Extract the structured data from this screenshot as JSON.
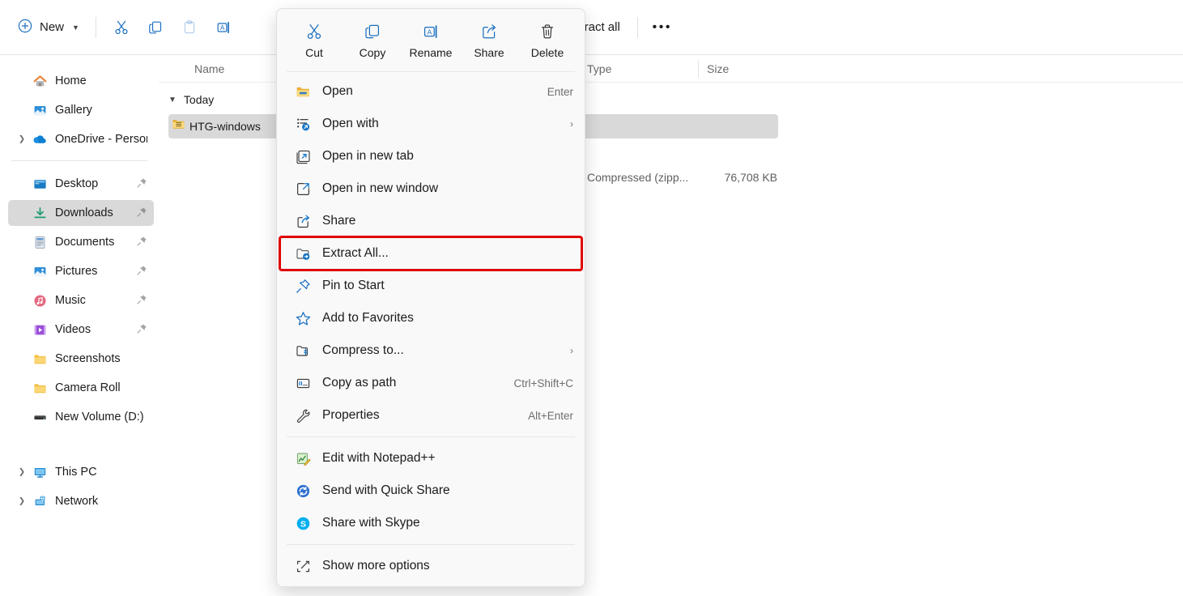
{
  "toolbar": {
    "new_label": "New",
    "new_chevron": "chevron-down-icon",
    "buttons": [
      {
        "name": "cut-icon",
        "label": "Cut",
        "enabled": true
      },
      {
        "name": "copy-icon",
        "label": "Copy",
        "enabled": true
      },
      {
        "name": "paste-icon",
        "label": "Paste",
        "enabled": false
      },
      {
        "name": "rename-icon",
        "label": "Rename",
        "enabled": true
      }
    ],
    "extract_all_label": "Extract all",
    "extract_all_icon": "extract-folder-icon",
    "overflow_label": "•••"
  },
  "sidebar": {
    "items": [
      {
        "label": "Home",
        "icon": "home-icon",
        "expandable": false,
        "pinned": false,
        "selected": false
      },
      {
        "label": "Gallery",
        "icon": "gallery-icon",
        "expandable": false,
        "pinned": false,
        "selected": false
      },
      {
        "label": "OneDrive - Persona",
        "icon": "onedrive-icon",
        "expandable": true,
        "pinned": false,
        "selected": false
      },
      {
        "separator": true
      },
      {
        "label": "Desktop",
        "icon": "desktop-icon",
        "expandable": false,
        "pinned": true,
        "selected": false
      },
      {
        "label": "Downloads",
        "icon": "downloads-icon",
        "expandable": false,
        "pinned": true,
        "selected": true
      },
      {
        "label": "Documents",
        "icon": "documents-icon",
        "expandable": false,
        "pinned": true,
        "selected": false
      },
      {
        "label": "Pictures",
        "icon": "pictures-icon",
        "expandable": false,
        "pinned": true,
        "selected": false
      },
      {
        "label": "Music",
        "icon": "music-icon",
        "expandable": false,
        "pinned": true,
        "selected": false
      },
      {
        "label": "Videos",
        "icon": "videos-icon",
        "expandable": false,
        "pinned": true,
        "selected": false
      },
      {
        "label": "Screenshots",
        "icon": "folder-icon",
        "expandable": false,
        "pinned": false,
        "selected": false
      },
      {
        "label": "Camera Roll",
        "icon": "folder-icon",
        "expandable": false,
        "pinned": false,
        "selected": false
      },
      {
        "label": "New Volume (D:)",
        "icon": "drive-icon",
        "expandable": false,
        "pinned": false,
        "selected": false
      },
      {
        "gap": true
      },
      {
        "label": "This PC",
        "icon": "this-pc-icon",
        "expandable": true,
        "pinned": false,
        "selected": false
      },
      {
        "label": "Network",
        "icon": "network-icon",
        "expandable": true,
        "pinned": false,
        "selected": false
      }
    ]
  },
  "file_list": {
    "columns": [
      "Name",
      "Type",
      "Size"
    ],
    "group_label": "Today",
    "group_chevron": "chevron-down-icon",
    "rows": [
      {
        "name": "HTG-windows",
        "icon": "zip-folder-icon",
        "type": "Compressed (zipp...",
        "size": "76,708 KB",
        "selected": true
      }
    ]
  },
  "context_menu": {
    "header": [
      {
        "label": "Cut",
        "icon": "cut-icon"
      },
      {
        "label": "Copy",
        "icon": "copy-icon"
      },
      {
        "label": "Rename",
        "icon": "rename-icon"
      },
      {
        "label": "Share",
        "icon": "share-icon"
      },
      {
        "label": "Delete",
        "icon": "delete-icon"
      }
    ],
    "items": [
      {
        "label": "Open",
        "icon": "folder-open-icon",
        "accel": "Enter",
        "submenu": false,
        "highlighted": false
      },
      {
        "label": "Open with",
        "icon": "open-with-icon",
        "accel": "",
        "submenu": true,
        "highlighted": false
      },
      {
        "label": "Open in new tab",
        "icon": "new-tab-icon",
        "accel": "",
        "submenu": false,
        "highlighted": false
      },
      {
        "label": "Open in new window",
        "icon": "new-window-icon",
        "accel": "",
        "submenu": false,
        "highlighted": false
      },
      {
        "label": "Share",
        "icon": "share-icon",
        "accel": "",
        "submenu": false,
        "highlighted": false
      },
      {
        "label": "Extract All...",
        "icon": "extract-folder-icon",
        "accel": "",
        "submenu": false,
        "highlighted": true
      },
      {
        "label": "Pin to Start",
        "icon": "pin-icon",
        "accel": "",
        "submenu": false,
        "highlighted": false
      },
      {
        "label": "Add to Favorites",
        "icon": "star-icon",
        "accel": "",
        "submenu": false,
        "highlighted": false
      },
      {
        "label": "Compress to...",
        "icon": "compress-icon",
        "accel": "",
        "submenu": true,
        "highlighted": false
      },
      {
        "label": "Copy as path",
        "icon": "copy-path-icon",
        "accel": "Ctrl+Shift+C",
        "submenu": false,
        "highlighted": false
      },
      {
        "label": "Properties",
        "icon": "properties-icon",
        "accel": "Alt+Enter",
        "submenu": false,
        "highlighted": false
      },
      {
        "separator": true
      },
      {
        "label": "Edit with Notepad++",
        "icon": "notepadpp-icon",
        "accel": "",
        "submenu": false,
        "highlighted": false
      },
      {
        "label": "Send with Quick Share",
        "icon": "quick-share-icon",
        "accel": "",
        "submenu": false,
        "highlighted": false
      },
      {
        "label": "Share with Skype",
        "icon": "skype-icon",
        "accel": "",
        "submenu": false,
        "highlighted": false
      },
      {
        "separator": true
      },
      {
        "label": "Show more options",
        "icon": "show-more-icon",
        "accel": "",
        "submenu": false,
        "highlighted": false
      }
    ],
    "submenu_glyph": "›"
  },
  "colors": {
    "accent": "#0f6cbd",
    "highlight_box": "#e00000",
    "selection": "#d9d9d9",
    "menu_bg": "#f9f9f9"
  }
}
